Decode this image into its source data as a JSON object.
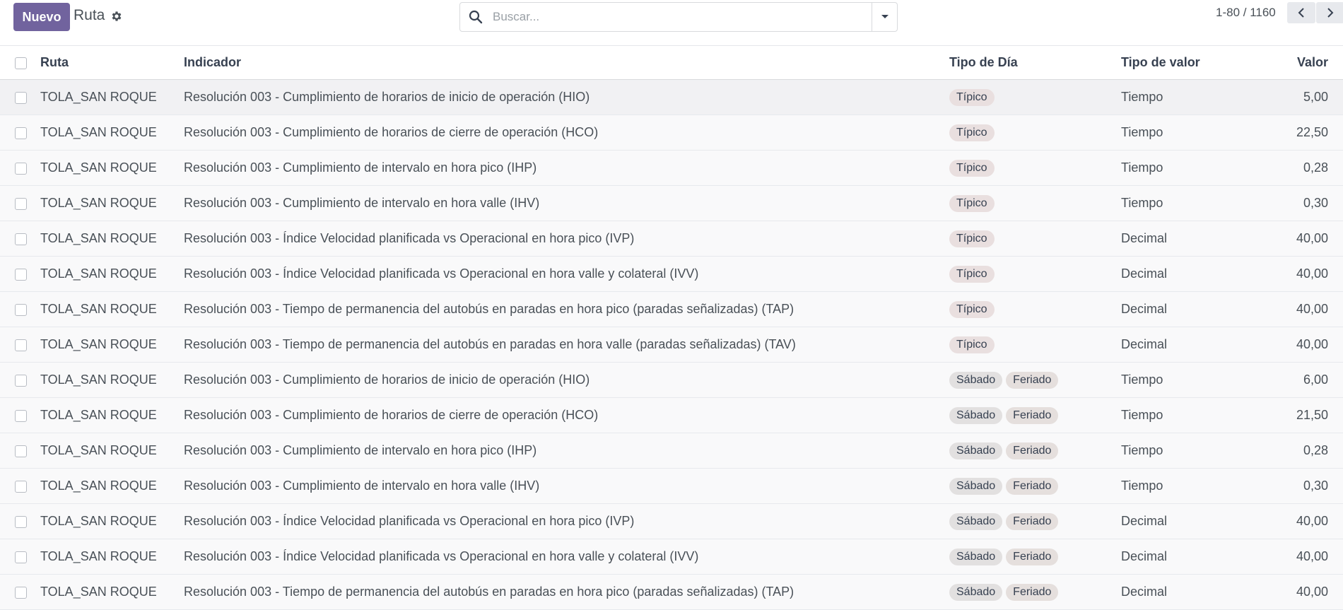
{
  "control_panel": {
    "new_button": "Nuevo",
    "breadcrumb": "Ruta",
    "search_placeholder": "Buscar...",
    "pager": "1-80 / 1160"
  },
  "icons": {
    "gear": "gear-icon",
    "search": "search-icon",
    "toggle": "caret-down-icon",
    "prev": "chevron-left-icon",
    "next": "chevron-right-icon"
  },
  "colors": {
    "primary": "#71639e",
    "badge_tipico": "#e9dfdf",
    "badge_other": "#e2e0e0"
  },
  "table": {
    "headers": {
      "ruta": "Ruta",
      "indicador": "Indicador",
      "tipo_dia": "Tipo de Día",
      "tipo_valor": "Tipo de valor",
      "valor": "Valor"
    },
    "rows": [
      {
        "ruta": "TOLA_SAN ROQUE",
        "indicador": "Resolución 003 - Cumplimiento de horarios de inicio de operación (HIO)",
        "tipo_dia": [
          "Típico"
        ],
        "tipo_valor": "Tiempo",
        "valor": "5,00"
      },
      {
        "ruta": "TOLA_SAN ROQUE",
        "indicador": "Resolución 003 - Cumplimiento de horarios de cierre de operación (HCO)",
        "tipo_dia": [
          "Típico"
        ],
        "tipo_valor": "Tiempo",
        "valor": "22,50"
      },
      {
        "ruta": "TOLA_SAN ROQUE",
        "indicador": "Resolución 003 - Cumplimiento de intervalo en hora pico (IHP)",
        "tipo_dia": [
          "Típico"
        ],
        "tipo_valor": "Tiempo",
        "valor": "0,28"
      },
      {
        "ruta": "TOLA_SAN ROQUE",
        "indicador": "Resolución 003 - Cumplimiento de intervalo en hora valle (IHV)",
        "tipo_dia": [
          "Típico"
        ],
        "tipo_valor": "Tiempo",
        "valor": "0,30"
      },
      {
        "ruta": "TOLA_SAN ROQUE",
        "indicador": "Resolución 003 - Índice Velocidad planificada vs Operacional en hora pico (IVP)",
        "tipo_dia": [
          "Típico"
        ],
        "tipo_valor": "Decimal",
        "valor": "40,00"
      },
      {
        "ruta": "TOLA_SAN ROQUE",
        "indicador": "Resolución 003 - Índice Velocidad planificada vs Operacional en hora valle y colateral (IVV)",
        "tipo_dia": [
          "Típico"
        ],
        "tipo_valor": "Decimal",
        "valor": "40,00"
      },
      {
        "ruta": "TOLA_SAN ROQUE",
        "indicador": "Resolución 003 - Tiempo de permanencia del autobús en paradas en hora pico (paradas señalizadas) (TAP)",
        "tipo_dia": [
          "Típico"
        ],
        "tipo_valor": "Decimal",
        "valor": "40,00"
      },
      {
        "ruta": "TOLA_SAN ROQUE",
        "indicador": "Resolución 003 - Tiempo de permanencia del autobús en paradas en hora valle (paradas señalizadas) (TAV)",
        "tipo_dia": [
          "Típico"
        ],
        "tipo_valor": "Decimal",
        "valor": "40,00"
      },
      {
        "ruta": "TOLA_SAN ROQUE",
        "indicador": "Resolución 003 - Cumplimiento de horarios de inicio de operación (HIO)",
        "tipo_dia": [
          "Sábado",
          "Feriado"
        ],
        "tipo_valor": "Tiempo",
        "valor": "6,00"
      },
      {
        "ruta": "TOLA_SAN ROQUE",
        "indicador": "Resolución 003 - Cumplimiento de horarios de cierre de operación (HCO)",
        "tipo_dia": [
          "Sábado",
          "Feriado"
        ],
        "tipo_valor": "Tiempo",
        "valor": "21,50"
      },
      {
        "ruta": "TOLA_SAN ROQUE",
        "indicador": "Resolución 003 - Cumplimiento de intervalo en hora pico (IHP)",
        "tipo_dia": [
          "Sábado",
          "Feriado"
        ],
        "tipo_valor": "Tiempo",
        "valor": "0,28"
      },
      {
        "ruta": "TOLA_SAN ROQUE",
        "indicador": "Resolución 003 - Cumplimiento de intervalo en hora valle (IHV)",
        "tipo_dia": [
          "Sábado",
          "Feriado"
        ],
        "tipo_valor": "Tiempo",
        "valor": "0,30"
      },
      {
        "ruta": "TOLA_SAN ROQUE",
        "indicador": "Resolución 003 - Índice Velocidad planificada vs Operacional en hora pico (IVP)",
        "tipo_dia": [
          "Sábado",
          "Feriado"
        ],
        "tipo_valor": "Decimal",
        "valor": "40,00"
      },
      {
        "ruta": "TOLA_SAN ROQUE",
        "indicador": "Resolución 003 - Índice Velocidad planificada vs Operacional en hora valle y colateral (IVV)",
        "tipo_dia": [
          "Sábado",
          "Feriado"
        ],
        "tipo_valor": "Decimal",
        "valor": "40,00"
      },
      {
        "ruta": "TOLA_SAN ROQUE",
        "indicador": "Resolución 003 - Tiempo de permanencia del autobús en paradas en hora pico (paradas señalizadas) (TAP)",
        "tipo_dia": [
          "Sábado",
          "Feriado"
        ],
        "tipo_valor": "Decimal",
        "valor": "40,00"
      }
    ]
  }
}
